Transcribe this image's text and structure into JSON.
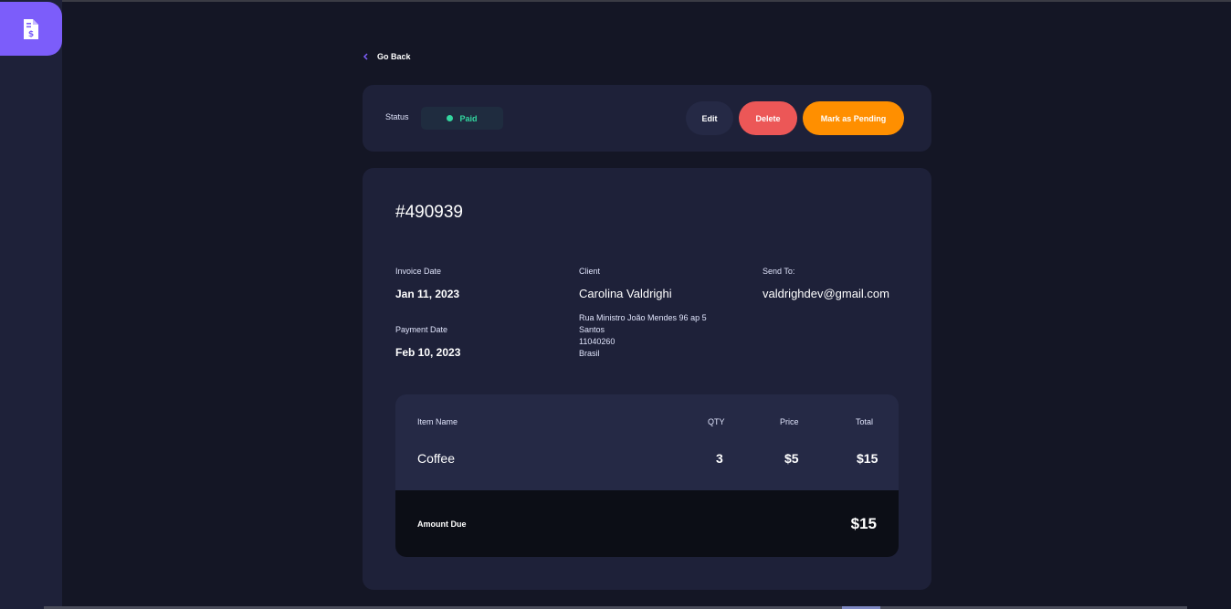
{
  "nav": {
    "back_label": "Go Back"
  },
  "status_bar": {
    "status_label": "Status",
    "status_value": "Paid",
    "edit_label": "Edit",
    "delete_label": "Delete",
    "mark_label": "Mark as Pending"
  },
  "invoice": {
    "id": "#490939",
    "invoice_date_label": "Invoice Date",
    "invoice_date": "Jan 11, 2023",
    "payment_date_label": "Payment Date",
    "payment_date": "Feb 10, 2023",
    "client_label": "Client",
    "client_name": "Carolina Valdrighi",
    "address": [
      "Rua Ministro João Mendes 96 ap 5",
      "Santos",
      "11040260",
      "Brasil"
    ],
    "send_to_label": "Send To:",
    "send_to": "valdrighdev@gmail.com"
  },
  "items": {
    "headers": {
      "name": "Item Name",
      "qty": "QTY",
      "price": "Price",
      "total": "Total"
    },
    "rows": [
      {
        "name": "Coffee",
        "qty": "3",
        "price": "$5",
        "total": "$15"
      }
    ],
    "amount_due_label": "Amount Due",
    "amount_due": "$15"
  },
  "colors": {
    "accent": "#7c5dfa",
    "paid": "#33d69f",
    "delete": "#ec5757",
    "pending": "#ff8f00"
  }
}
